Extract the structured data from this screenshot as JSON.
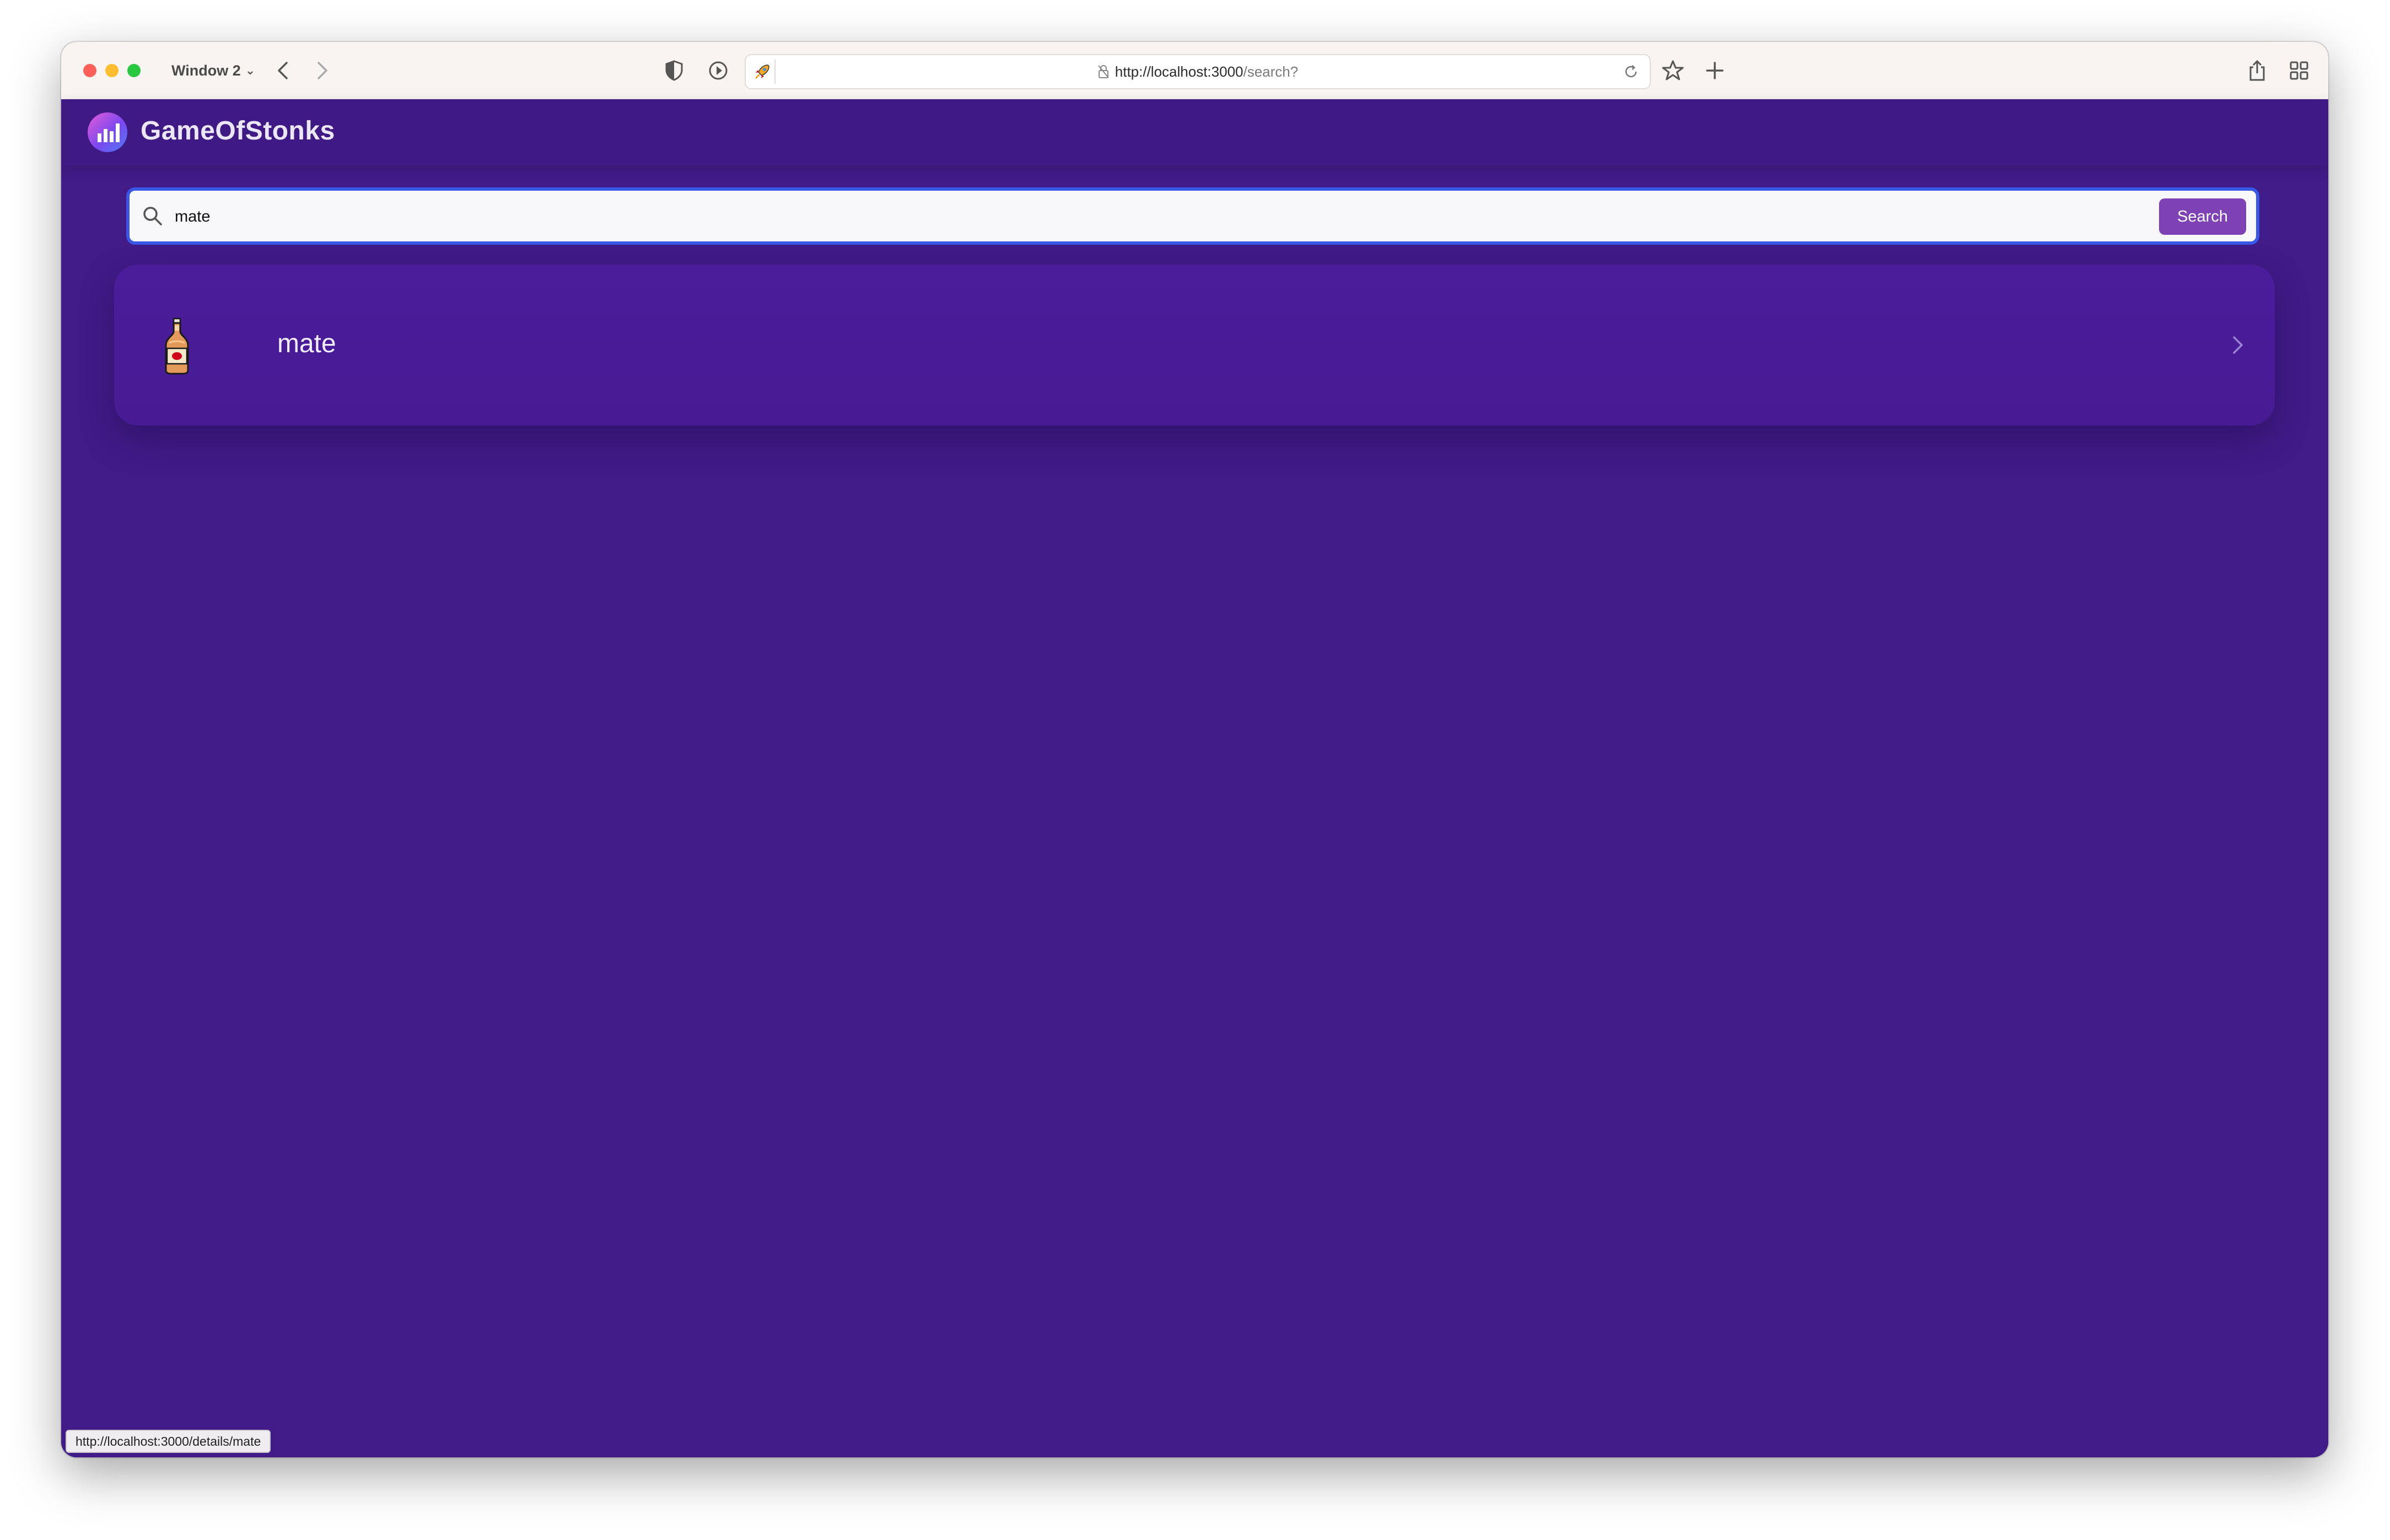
{
  "browser": {
    "window_menu_label": "Window 2",
    "url_host": "http://localhost:3000",
    "url_path": "/search?",
    "status_link": "http://localhost:3000/details/mate"
  },
  "app": {
    "brand": "GameOfStonks",
    "search": {
      "value": "mate",
      "button_label": "Search"
    },
    "results": [
      {
        "label": "mate",
        "icon": "beer-bottle-icon"
      }
    ]
  },
  "colors": {
    "page_background": "#411b87",
    "card_background": "#4a1d9b",
    "search_button": "#7f42b5",
    "search_focus_ring": "#3a58e6"
  }
}
